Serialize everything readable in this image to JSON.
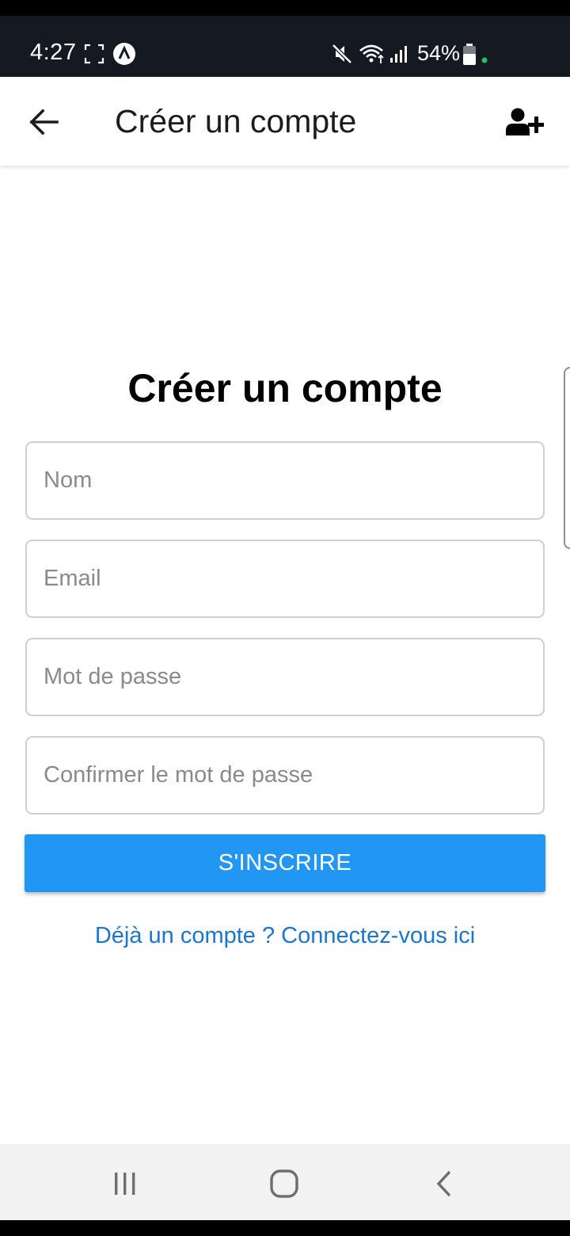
{
  "status_bar": {
    "time": "4:27",
    "battery": "54%",
    "icons": [
      "screenshot-frame-icon",
      "app-notification-icon",
      "mute-icon",
      "wifi-icon",
      "signal-icon",
      "battery-icon",
      "green-dot-indicator"
    ]
  },
  "app_bar": {
    "title": "Créer un compte",
    "back_icon": "arrow-left-icon",
    "action_icon": "user-plus-icon"
  },
  "form": {
    "title": "Créer un compte",
    "fields": [
      {
        "name": "name",
        "placeholder": "Nom",
        "value": ""
      },
      {
        "name": "email",
        "placeholder": "Email",
        "value": ""
      },
      {
        "name": "password",
        "placeholder": "Mot de passe",
        "value": ""
      },
      {
        "name": "confirm_password",
        "placeholder": "Confirmer le mot de passe",
        "value": ""
      }
    ],
    "submit_label": "S'INSCRIRE",
    "login_link": "Déjà un compte ? Connectez-vous ici"
  },
  "nav_bar": {
    "items": [
      "recent-apps-icon",
      "home-icon",
      "back-icon"
    ]
  },
  "colors": {
    "status_bar_bg": "#151922",
    "primary": "#2196f3",
    "link": "#1976d2",
    "indicator_green": "#22c55e"
  }
}
